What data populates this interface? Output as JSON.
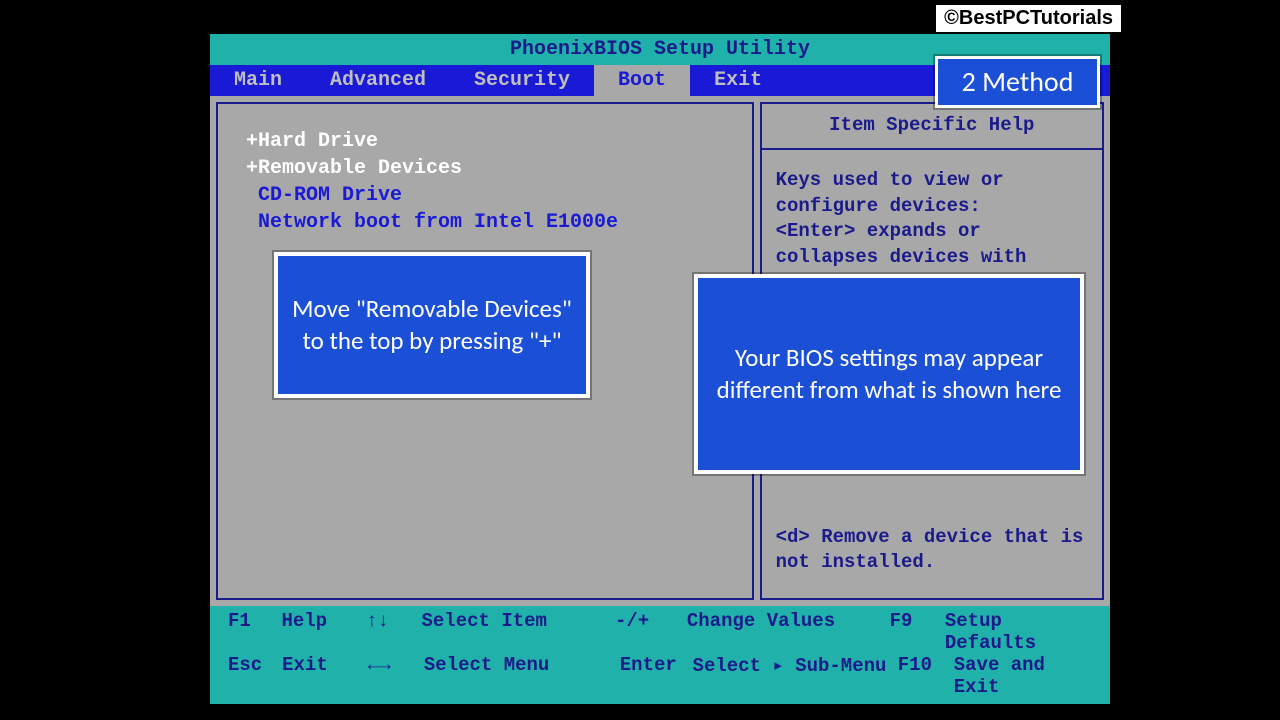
{
  "watermark": "©BestPCTutorials",
  "title": "PhoenixBIOS Setup Utility",
  "menu": {
    "items": [
      "Main",
      "Advanced",
      "Security",
      "Boot",
      "Exit"
    ],
    "active_index": 3
  },
  "boot_list": [
    {
      "label": "+Hard Drive",
      "selected": false,
      "color": "white"
    },
    {
      "label": "+Removable Devices",
      "selected": true,
      "color": "white"
    },
    {
      "label": " CD-ROM Drive",
      "selected": false,
      "color": "blue"
    },
    {
      "label": " Network boot from Intel E1000e",
      "selected": false,
      "color": "blue"
    }
  ],
  "help": {
    "title": "Item Specific Help",
    "body_top": "Keys used to view or configure devices:\n<Enter> expands or collapses devices with",
    "body_bottom": "<d> Remove a device that is not installed."
  },
  "footer": {
    "r1": {
      "k1": "F1",
      "l1": "Help",
      "arr": "↑↓",
      "a1": "Select Item",
      "sym": "-/+",
      "a2": "Change Values",
      "k2": "F9",
      "l2": "Setup Defaults"
    },
    "r2": {
      "k1": "Esc",
      "l1": "Exit",
      "arr": "←→",
      "a1": "Select Menu",
      "sym": "Enter",
      "a2": "Select ▸ Sub-Menu",
      "k2": "F10",
      "l2": "Save and Exit"
    }
  },
  "overlays": {
    "method": "2 Method",
    "left": "Move \"Removable Devices\" to the top by pressing \"+\"",
    "right": "Your BIOS settings may appear different from what is shown here"
  }
}
